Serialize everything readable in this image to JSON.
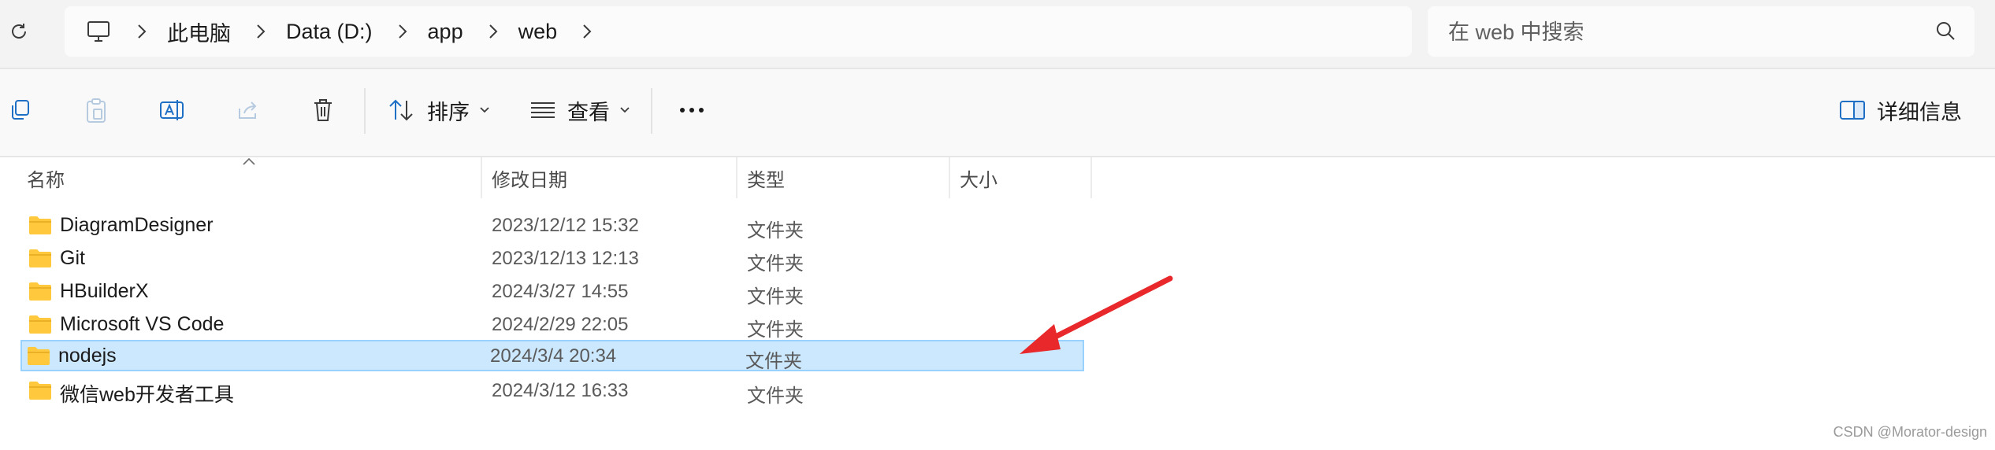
{
  "address": {
    "breadcrumbs": [
      "此电脑",
      "Data (D:)",
      "app",
      "web"
    ]
  },
  "search": {
    "placeholder": "在 web 中搜索"
  },
  "toolbar": {
    "sort_label": "排序",
    "view_label": "查看",
    "details_label": "详细信息"
  },
  "columns": {
    "name": "名称",
    "date": "修改日期",
    "type": "类型",
    "size": "大小"
  },
  "files": [
    {
      "name": "DiagramDesigner",
      "date": "2023/12/12 15:32",
      "type": "文件夹"
    },
    {
      "name": "Git",
      "date": "2023/12/13 12:13",
      "type": "文件夹"
    },
    {
      "name": "HBuilderX",
      "date": "2024/3/27 14:55",
      "type": "文件夹"
    },
    {
      "name": "Microsoft VS Code",
      "date": "2024/2/29 22:05",
      "type": "文件夹"
    },
    {
      "name": "nodejs",
      "date": "2024/3/4 20:34",
      "type": "文件夹",
      "selected": true
    },
    {
      "name": "微信web开发者工具",
      "date": "2024/3/12 16:33",
      "type": "文件夹"
    }
  ],
  "watermark": "CSDN @Morator-design",
  "colors": {
    "selection": "#cce8ff",
    "folder": "#ffc83d",
    "annotation_arrow": "#e8282b"
  }
}
